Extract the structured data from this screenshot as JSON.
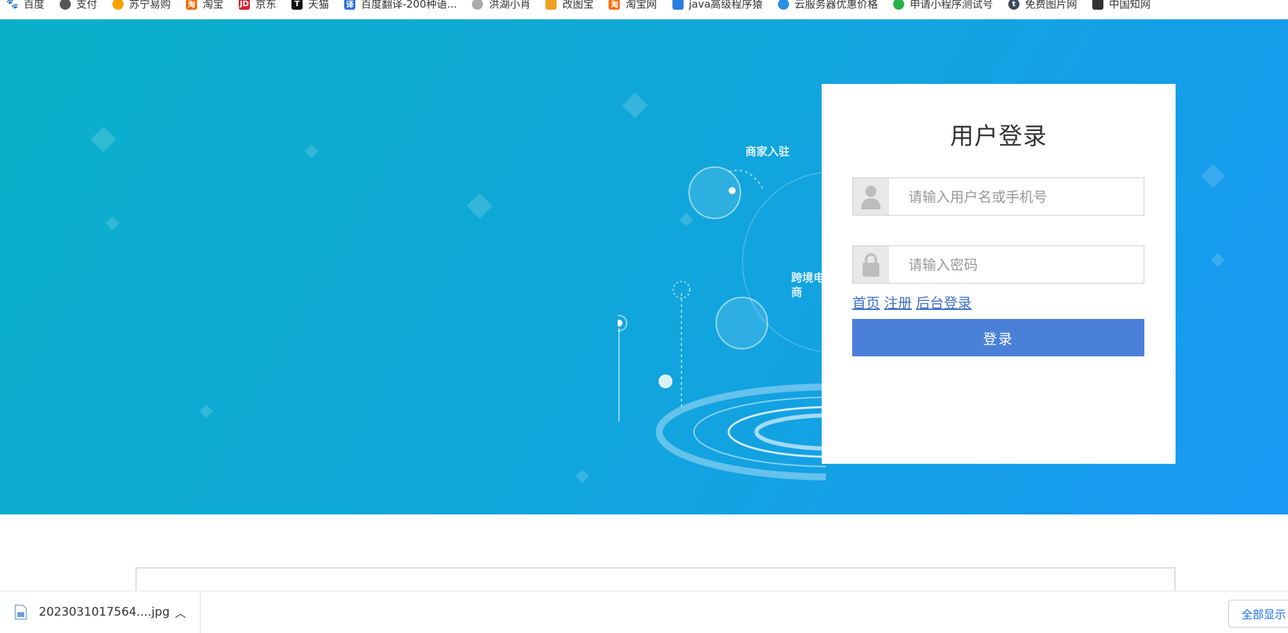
{
  "bookmarks": [
    {
      "label": "百度",
      "icon": "baidu-paw-icon",
      "color": "#3050c8"
    },
    {
      "label": "支付",
      "icon": "globe-icon",
      "color": "#555555"
    },
    {
      "label": "苏宁易购",
      "icon": "suning-lion-icon",
      "color": "#f5a000"
    },
    {
      "label": "淘宝",
      "icon": "taobao-icon",
      "color": "#ff6a00"
    },
    {
      "label": "京东",
      "icon": "jd-icon",
      "color": "#d42030"
    },
    {
      "label": "天猫",
      "icon": "tmall-icon",
      "color": "#d40010"
    },
    {
      "label": "百度翻译-200种语...",
      "icon": "translate-icon",
      "color": "#2d6fe0"
    },
    {
      "label": "洪湖小肖",
      "icon": "bird-icon",
      "color": "#888888"
    },
    {
      "label": "改图宝",
      "icon": "image-tool-icon",
      "color": "#f0a020"
    },
    {
      "label": "淘宝网",
      "icon": "taobao-icon",
      "color": "#ff6a00"
    },
    {
      "label": "java高级程序猿",
      "icon": "robot-icon",
      "color": "#2b7de0"
    },
    {
      "label": "云服务器优惠价格",
      "icon": "cloud-icon",
      "color": "#2b8fe0"
    },
    {
      "label": "申请小程序测试号",
      "icon": "wechat-icon",
      "color": "#2ab14a"
    },
    {
      "label": "免费图片网",
      "icon": "t-logo-icon",
      "color": "#3a4a5a"
    },
    {
      "label": "中国知网",
      "icon": "cnki-icon",
      "color": "#333333"
    }
  ],
  "hero": {
    "bubble1": "商家入驻",
    "bubble2": "跨境电商"
  },
  "login": {
    "title": "用户登录",
    "username_placeholder": "请输入用户名或手机号",
    "password_placeholder": "请输入密码",
    "links": [
      "首页",
      "注册",
      "后台登录"
    ],
    "submit_label": "登录",
    "user_icon": "user-icon",
    "lock_icon": "lock-icon"
  },
  "downloads": {
    "file_name": "2023031017564....jpg",
    "show_all": "全部显示"
  }
}
